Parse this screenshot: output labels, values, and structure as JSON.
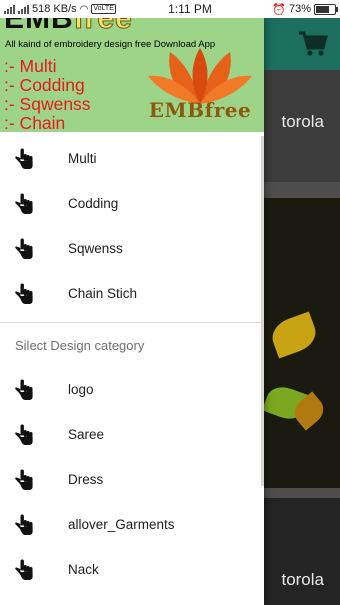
{
  "status_bar": {
    "speed": "518 KB/s",
    "volte": "VoLTE",
    "time": "1:11 PM",
    "battery": "73%",
    "battery_level": 0.73
  },
  "header": {
    "brand_prefix": "EMB",
    "brand_suffix": "free",
    "tagline": "All kaind of embroidery design free Download App",
    "lines": [
      ":- Multi",
      ":- Codding",
      ":- Sqwenss",
      ":- Chain"
    ],
    "logo_text": "EMBfree"
  },
  "background": {
    "brand_text_1": "torola",
    "brand_text_3": "torola"
  },
  "menu_items": [
    {
      "label": "Multi",
      "icon": "hand-pointer-icon"
    },
    {
      "label": "Codding",
      "icon": "hand-pointer-icon"
    },
    {
      "label": "Sqwenss",
      "icon": "hand-pointer-icon"
    },
    {
      "label": "Chain Stich",
      "icon": "hand-pointer-icon"
    }
  ],
  "category_section": {
    "title": "Silect Design category",
    "items": [
      {
        "label": "logo",
        "icon": "hand-pointer-icon"
      },
      {
        "label": "Saree",
        "icon": "hand-pointer-icon"
      },
      {
        "label": "Dress",
        "icon": "hand-pointer-icon"
      },
      {
        "label": "allover_Garments",
        "icon": "hand-pointer-icon"
      },
      {
        "label": "Nack",
        "icon": "hand-pointer-icon"
      }
    ]
  },
  "colors": {
    "header_bg": "#9ed488",
    "header_text": "#e51c1c",
    "toolbar": "#1b6f5c"
  }
}
